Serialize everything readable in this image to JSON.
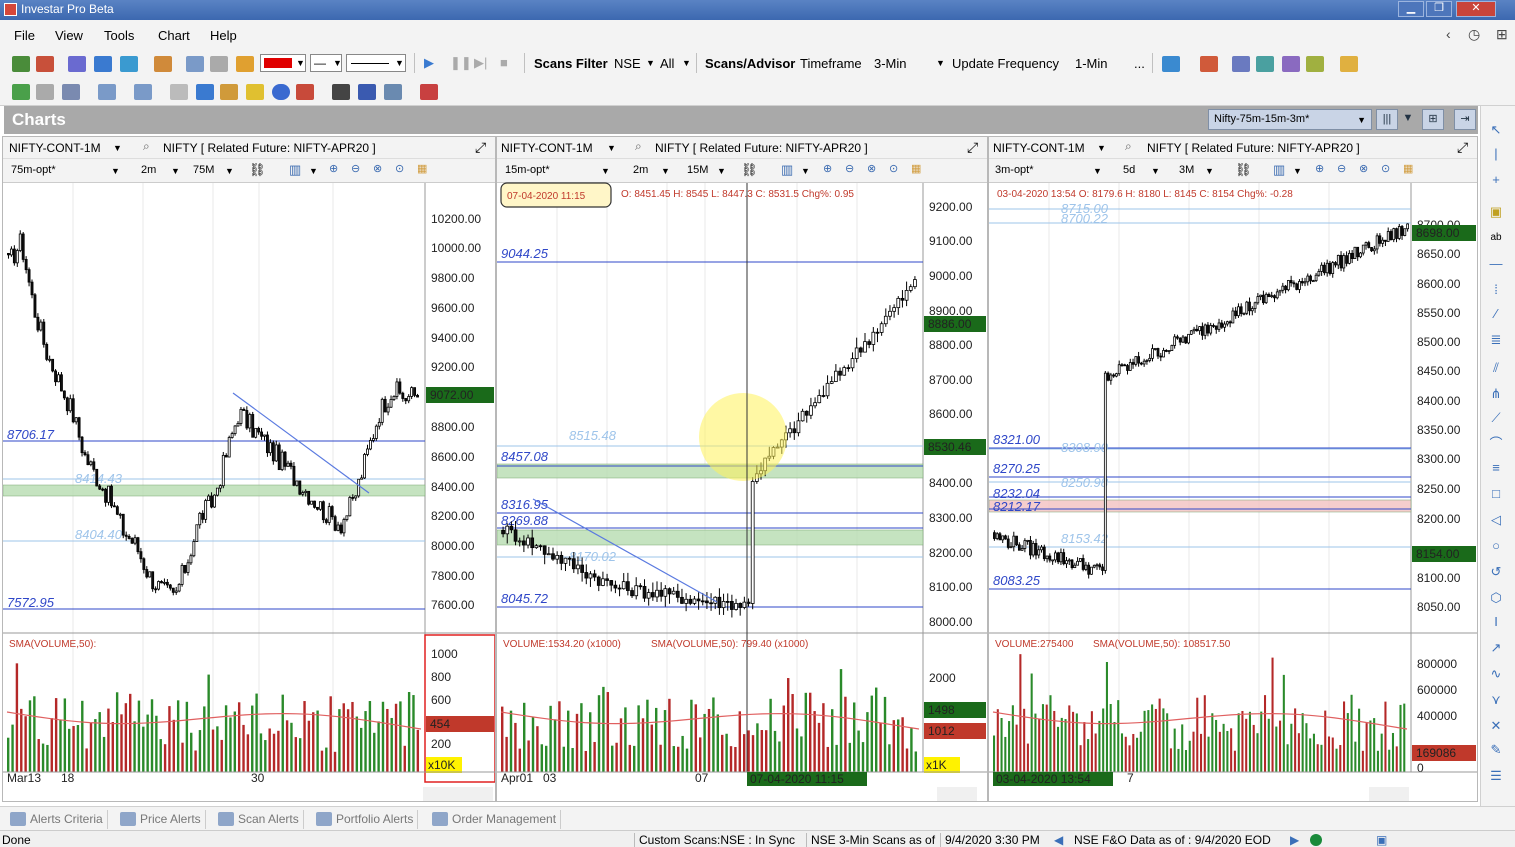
{
  "window": {
    "title": "Investar Pro Beta"
  },
  "menu": {
    "items": [
      "File",
      "View",
      "Tools",
      "Chart",
      "Help"
    ]
  },
  "toolbar": {
    "scans_filter_label": "Scans Filter",
    "exchange": "NSE",
    "scope": "All",
    "scans_advisor_label": "Scans/Advisor",
    "timeframe_label": "Timeframe",
    "timeframe_value": "3-Min",
    "update_freq_label": "Update Frequency",
    "update_freq_value": "1-Min",
    "more": "...",
    "line_color": "#e00000"
  },
  "charts_header": {
    "title": "Charts",
    "layout": "Nifty-75m-15m-3m*"
  },
  "panels": [
    {
      "symbol": "NIFTY-CONT-1M",
      "related": "NIFTY [ Related Future: NIFTY-APR20 ]",
      "template": "75m-opt*",
      "period": "2m",
      "interval": "75M",
      "ohlc": "",
      "price_ticks": [
        "10200.00",
        "10000.00",
        "9800.00",
        "9600.00",
        "9400.00",
        "9200.00",
        "8800.00",
        "8600.00",
        "8400.00",
        "8200.00",
        "8000.00",
        "7800.00",
        "7600.00"
      ],
      "last_price": "9072.00",
      "lines": [
        {
          "label": "8706.17",
          "style": "dark"
        },
        {
          "label": "8404.40",
          "style": "light"
        },
        {
          "label": "8414.43",
          "style": "light"
        },
        {
          "label": "7572.95",
          "style": "dark"
        }
      ],
      "volume_label": "SMA(VOLUME,50):",
      "volume_ticks": [
        "1000",
        "800",
        "600",
        "200"
      ],
      "volume_last": "454",
      "volume_unit": "x10K",
      "date_labels": [
        "Mar13",
        "18",
        "30"
      ],
      "cursor_date": ""
    },
    {
      "symbol": "NIFTY-CONT-1M",
      "related": "NIFTY [ Related Future: NIFTY-APR20 ]",
      "template": "15m-opt*",
      "period": "2m",
      "interval": "15M",
      "ohlc_date": "07-04-2020 11:15",
      "ohlc": "O: 8451.45  H: 8545  L: 8447.3  C: 8531.5  Chg%: 0.95",
      "price_ticks": [
        "9200.00",
        "9100.00",
        "9000.00",
        "8900.00",
        "8800.00",
        "8700.00",
        "8600.00",
        "8400.00",
        "8300.00",
        "8200.00",
        "8100.00",
        "8000.00"
      ],
      "last_price": "8886.00",
      "cursor_price": "8530.46",
      "lines": [
        {
          "label": "9044.25",
          "style": "dark"
        },
        {
          "label": "8515.48",
          "style": "light"
        },
        {
          "label": "8457.08",
          "style": "dark"
        },
        {
          "label": "8316.95",
          "style": "dark"
        },
        {
          "label": "8269.88",
          "style": "dark"
        },
        {
          "label": "8170.02",
          "style": "light"
        },
        {
          "label": "8045.72",
          "style": "dark"
        }
      ],
      "volume_label": "VOLUME:1534.20 (x1000)",
      "volume_sma": "SMA(VOLUME,50): 799.40 (x1000)",
      "volume_ticks": [
        "2000"
      ],
      "volume_last": "1498",
      "volume_sma_last": "1012",
      "volume_unit": "x1K",
      "date_labels": [
        "Apr01",
        "03",
        "07"
      ],
      "cursor_date": "07-04-2020 11:15"
    },
    {
      "symbol": "NIFTY-CONT-1M",
      "related": "NIFTY [ Related Future: NIFTY-APR20 ]",
      "template": "3m-opt*",
      "period": "5d",
      "interval": "3M",
      "ohlc": "03-04-2020 13:54  O: 8179.6  H: 8180  L: 8145  C: 8154  Chg%: -0.28",
      "price_ticks": [
        "8700.00",
        "8650.00",
        "8600.00",
        "8550.00",
        "8500.00",
        "8450.00",
        "8400.00",
        "8350.00",
        "8300.00",
        "8250.00",
        "8200.00",
        "8100.00",
        "8050.00"
      ],
      "last_price": "8698.00",
      "cursor_price": "8154.00",
      "lines": [
        {
          "label": "8715.00",
          "style": "light"
        },
        {
          "label": "8700.22",
          "style": "light"
        },
        {
          "label": "8321.00",
          "style": "dark"
        },
        {
          "label": "8308.90",
          "style": "light"
        },
        {
          "label": "8270.25",
          "style": "dark"
        },
        {
          "label": "8250.98",
          "style": "light"
        },
        {
          "label": "8232.04",
          "style": "dark"
        },
        {
          "label": "8212.17",
          "style": "dark"
        },
        {
          "label": "8153.42",
          "style": "light"
        },
        {
          "label": "8083.25",
          "style": "dark"
        }
      ],
      "volume_label": "VOLUME:275400",
      "volume_sma": "SMA(VOLUME,50): 108517.50",
      "volume_ticks": [
        "800000",
        "600000",
        "400000",
        "0"
      ],
      "volume_last": "169086",
      "date_labels": [
        "7"
      ],
      "cursor_date": "03-04-2020 13:54"
    }
  ],
  "bottom_tabs": [
    "Alerts Criteria",
    "Price Alerts",
    "Scan Alerts",
    "Portfolio Alerts",
    "Order Management"
  ],
  "status": {
    "left": "Done",
    "custom_scans": "Custom Scans:NSE : In Sync",
    "nse_scans": "NSE 3-Min Scans as of",
    "nse_scans_time": "9/4/2020 3:30 PM",
    "fo_data": "NSE F&O Data as of : 9/4/2020 EOD"
  },
  "colors": {
    "up": "#1a7a1a",
    "down": "#7a1a1a",
    "line_dark": "#2f47c8",
    "line_light": "#9ec4ea",
    "vol_up": "#2a8a2a",
    "vol_down": "#b42828"
  }
}
